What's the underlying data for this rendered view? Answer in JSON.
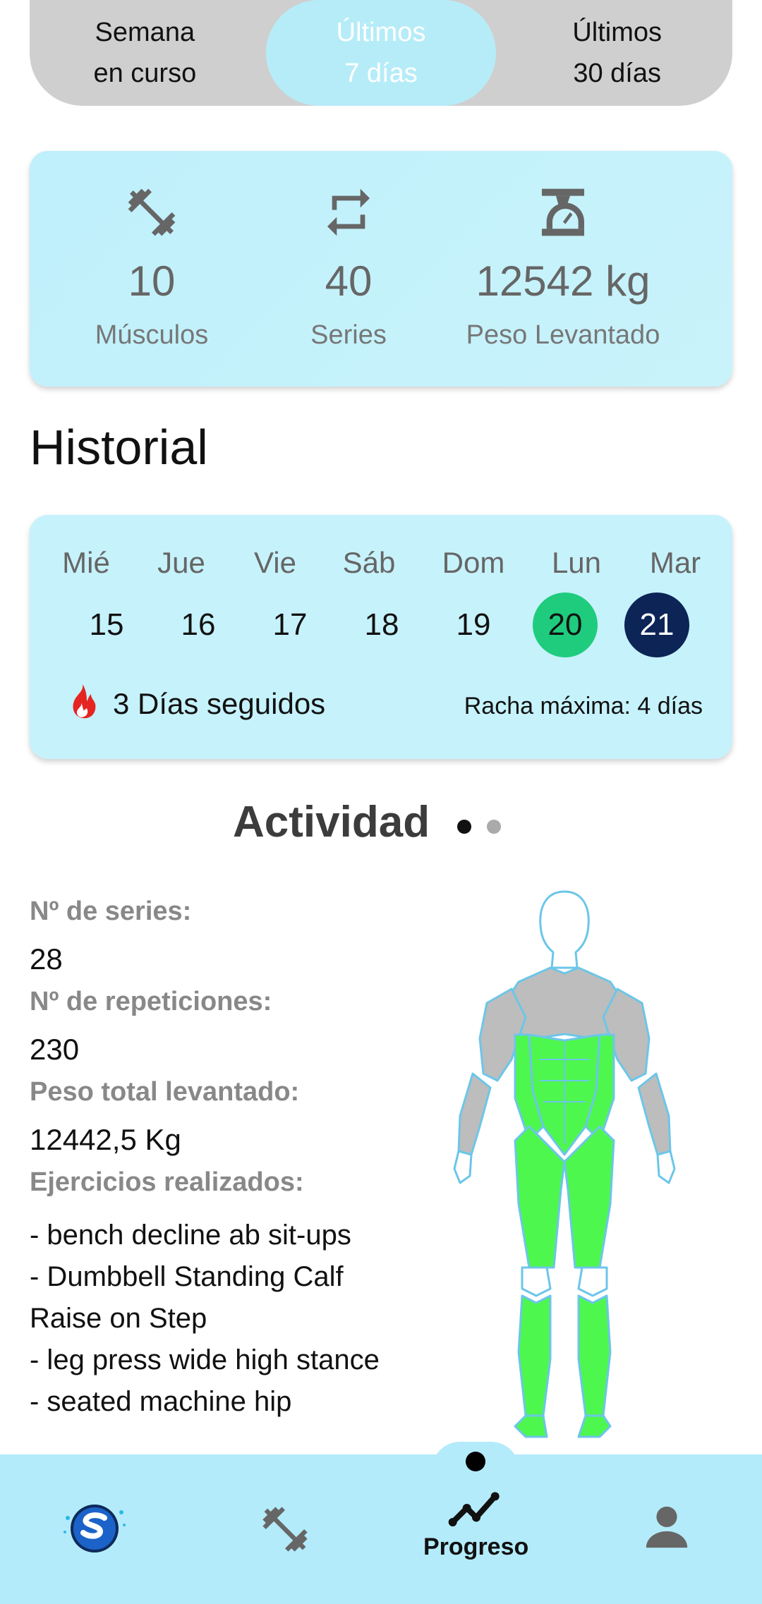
{
  "period_tabs": [
    {
      "label": "Semana\nen curso",
      "active": false
    },
    {
      "label": "Últimos\n7 días",
      "active": true
    },
    {
      "label": "Últimos\n30 días",
      "active": false
    }
  ],
  "stats": {
    "muscles": {
      "value": "10",
      "label": "Músculos",
      "icon": "dumbbell-icon"
    },
    "series": {
      "value": "40",
      "label": "Series",
      "icon": "repeat-icon"
    },
    "weight": {
      "value": "12542 kg",
      "label": "Peso Levantado",
      "icon": "scale-icon"
    }
  },
  "history": {
    "title": "Historial",
    "days": [
      {
        "name": "Mié",
        "num": "15",
        "state": "none"
      },
      {
        "name": "Jue",
        "num": "16",
        "state": "none"
      },
      {
        "name": "Vie",
        "num": "17",
        "state": "none"
      },
      {
        "name": "Sáb",
        "num": "18",
        "state": "none"
      },
      {
        "name": "Dom",
        "num": "19",
        "state": "none"
      },
      {
        "name": "Lun",
        "num": "20",
        "state": "done"
      },
      {
        "name": "Mar",
        "num": "21",
        "state": "today"
      }
    ],
    "streak": "3 Días seguidos",
    "max_streak": "Racha máxima: 4 días"
  },
  "activity": {
    "title": "Actividad",
    "series_label": "Nº de series:",
    "series_value": "28",
    "reps_label": "Nº de repeticiones:",
    "reps_value": "230",
    "weight_label": "Peso total levantado:",
    "weight_value": "12442,5  Kg",
    "exercises_label": "Ejercicios realizados:",
    "exercises": [
      "- bench decline ab sit-ups",
      "- Dumbbell Standing Calf Raise on Step",
      "- leg press wide high stance",
      "- seated machine hip"
    ]
  },
  "nav": {
    "items": [
      {
        "name": "logo-icon",
        "label": ""
      },
      {
        "name": "dumbbell-icon",
        "label": ""
      },
      {
        "name": "trend-icon",
        "label": "Progreso"
      },
      {
        "name": "person-icon",
        "label": ""
      }
    ]
  },
  "colors": {
    "accent_light": "#b6ecf8",
    "card_bg": "#c6f2fb",
    "done_day": "#1fcc7e",
    "today_day": "#0c2456",
    "muscle_worked": "#4ef74e",
    "muscle_idle": "#bdbdbd",
    "nav_bg": "#b3ebfa"
  }
}
